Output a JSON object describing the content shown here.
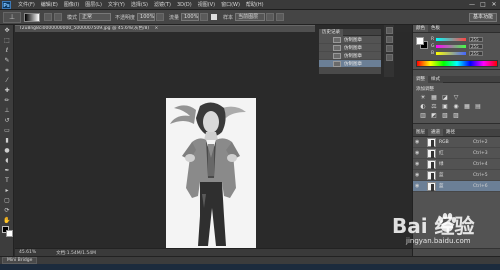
{
  "menubar": {
    "logo": "Ps",
    "items": [
      "文件(F)",
      "编辑(E)",
      "图像(I)",
      "图层(L)",
      "文字(Y)",
      "选择(S)",
      "滤镜(T)",
      "3D(D)",
      "视图(V)",
      "窗口(W)",
      "帮助(H)"
    ],
    "window_controls": [
      "—",
      "□",
      "✕"
    ]
  },
  "options": {
    "mode_label": "模式",
    "mode_value": "正常",
    "opacity_label": "不透明度",
    "opacity_value": "100%",
    "flow_label": "流量",
    "flow_value": "100%",
    "sample_label": "样本",
    "sample_value": "当前图层",
    "workspace": "基本功能"
  },
  "document": {
    "tab_title": "T2u8ng8ci0000000000_5000007509.jpg @ 45.6%(灰色/8)",
    "close": "×"
  },
  "status": {
    "zoom": "45.61%",
    "doc_size": "文档:1.54M/1.54M"
  },
  "mini_bridge": "Mini Bridge",
  "history": {
    "tab": "历史记录",
    "rows": [
      {
        "label": "仿制图章",
        "active": false
      },
      {
        "label": "仿制图章",
        "active": false
      },
      {
        "label": "仿制图章",
        "active": false
      },
      {
        "label": "仿制图章",
        "active": true
      }
    ]
  },
  "color_panel": {
    "tabs": [
      "颜色",
      "色板"
    ],
    "sliders": [
      {
        "label": "R",
        "value": "255",
        "color": "#ff4444"
      },
      {
        "label": "G",
        "value": "255",
        "color": "#44ff44"
      },
      {
        "label": "B",
        "value": "255",
        "color": "#4466ff"
      }
    ]
  },
  "adjustments": {
    "tabs": [
      "调整",
      "样式"
    ],
    "title": "添加调整",
    "row1": [
      "☀",
      "▦",
      "◪",
      "▽"
    ],
    "row2": [
      "◐",
      "⚖",
      "▣",
      "◉",
      "▦",
      "▤"
    ],
    "row3": [
      "▥",
      "◩",
      "▧",
      "▨"
    ]
  },
  "layers": {
    "tabs": [
      "图层",
      "通道",
      "路径"
    ],
    "rows": [
      {
        "name": "RGB",
        "shortcut": "Ctrl+2",
        "active": false
      },
      {
        "name": "红",
        "shortcut": "Ctrl+3",
        "active": false
      },
      {
        "name": "绿",
        "shortcut": "Ctrl+4",
        "active": false
      },
      {
        "name": "蓝",
        "shortcut": "Ctrl+5",
        "active": false
      },
      {
        "name": "蓝",
        "shortcut": "Ctrl+6",
        "active": true
      }
    ]
  },
  "watermark": {
    "text": "Bai  经验",
    "url": "jingyan.baidu.com"
  }
}
